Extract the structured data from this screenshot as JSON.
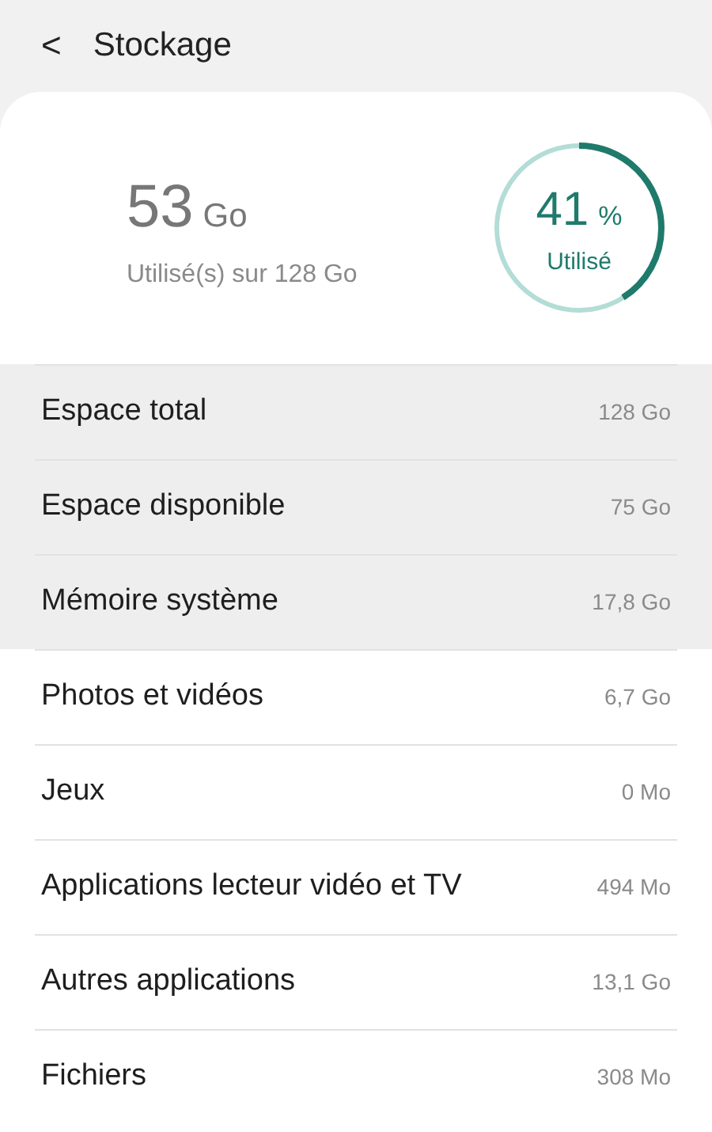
{
  "header": {
    "back": "<",
    "title": "Stockage"
  },
  "summary": {
    "used": "53",
    "used_unit": "Go",
    "caption": "Utilisé(s) sur 128 Go",
    "percent": "41",
    "percent_sign": "%",
    "percent_caption": "Utilisé",
    "level": 0.41
  },
  "rows": [
    {
      "label": "Espace total",
      "value": "128 Go",
      "highlighted": true
    },
    {
      "label": "Espace disponible",
      "value": "75 Go",
      "highlighted": true
    },
    {
      "label": "Mémoire système",
      "value": "17,8 Go",
      "highlighted": true
    },
    {
      "label": "Photos et vidéos",
      "value": "6,7 Go",
      "highlighted": false
    },
    {
      "label": "Jeux",
      "value": "0 Mo",
      "highlighted": false
    },
    {
      "label": "Applications lecteur vidéo et TV",
      "value": "494 Mo",
      "highlighted": false
    },
    {
      "label": "Autres applications",
      "value": "13,1 Go",
      "highlighted": false
    },
    {
      "label": "Fichiers",
      "value": "308 Mo",
      "highlighted": false
    }
  ]
}
